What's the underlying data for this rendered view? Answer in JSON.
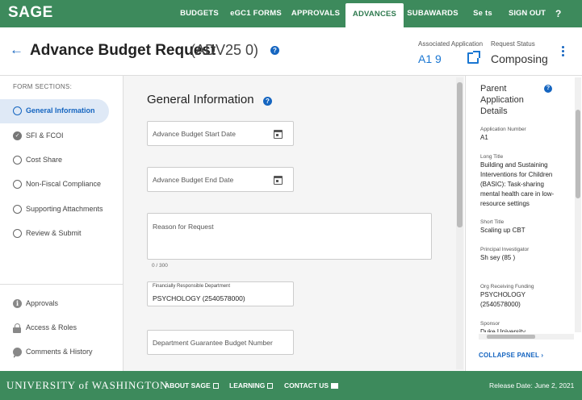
{
  "app": {
    "logo": "SAGE"
  },
  "nav": {
    "tabs": [
      {
        "label": "BUDGETS"
      },
      {
        "label": "eGC1 FORMS"
      },
      {
        "label": "APPROVALS"
      },
      {
        "label": "ADVANCES"
      },
      {
        "label": "SUBAWARDS"
      },
      {
        "label": "Se      ts"
      }
    ],
    "active_tab": "ADVANCES",
    "signout": "SIGN OUT",
    "help": "?"
  },
  "header": {
    "title": "Advance Budget Request",
    "request_id": "(ADV25    0)",
    "assoc_label": "Associated Application",
    "assoc_value": "A1     9",
    "status_label": "Request Status",
    "status_value": "Composing"
  },
  "sidebar": {
    "heading": "FORM SECTIONS:",
    "sections": [
      {
        "label": "General Information",
        "state": "active"
      },
      {
        "label": "SFI & FCOI",
        "state": "complete"
      },
      {
        "label": "Cost Share",
        "state": "incomplete"
      },
      {
        "label": "Non-Fiscal Compliance",
        "state": "incomplete"
      },
      {
        "label": "Supporting Attachments",
        "state": "incomplete"
      },
      {
        "label": "Review & Submit",
        "state": "incomplete"
      }
    ],
    "utilities": [
      {
        "label": "Approvals",
        "icon": "info-icon"
      },
      {
        "label": "Access & Roles",
        "icon": "lock-icon"
      },
      {
        "label": "Comments & History",
        "icon": "comment-icon"
      }
    ]
  },
  "main": {
    "section_title": "General Information",
    "start_date_placeholder": "Advance Budget Start Date",
    "end_date_placeholder": "Advance Budget End Date",
    "reason_placeholder": "Reason for Request",
    "reason_counter": "0 / 300",
    "dept_label": "Financially Responsible Department",
    "dept_value": "PSYCHOLOGY (2540578000)",
    "guarantee_placeholder": "Department Guarantee Budget Number"
  },
  "right_panel": {
    "title": "Parent Application Details",
    "fields": [
      {
        "label": "Application Number",
        "value": "A1     "
      },
      {
        "label": "Long Title",
        "value": "Building and Sustaining Interventions for Children (BASIC): Task-sharing mental health care in low-resource settings"
      },
      {
        "label": "Short Title",
        "value": "Scaling up CBT"
      },
      {
        "label": "Principal Investigator",
        "value": "Sh          sey (85       )"
      },
      {
        "label": "Org Receiving Funding",
        "value": "PSYCHOLOGY (2540578000)"
      },
      {
        "label": "Sponsor",
        "value": "Duke University"
      }
    ],
    "collapse": "COLLAPSE PANEL ›"
  },
  "footer": {
    "university": "UNIVERSITY of WASHINGTON",
    "links": [
      "ABOUT SAGE",
      "LEARNING",
      "CONTACT US"
    ],
    "release": "Release Date: June 2, 2021"
  },
  "colors": {
    "brand_green": "#3d8a5c",
    "accent_blue": "#1565c0"
  }
}
